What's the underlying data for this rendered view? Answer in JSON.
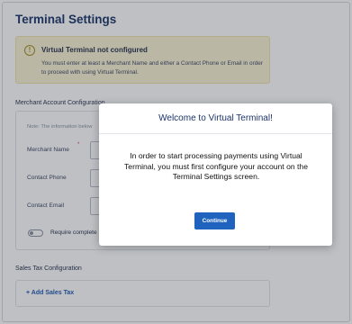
{
  "page": {
    "title": "Terminal Settings"
  },
  "alert": {
    "icon": "warning-circle-icon",
    "title": "Virtual Terminal not configured",
    "body": "You must enter at least a Merchant Name and either a Contact Phone or Email in order to proceed with using Virtual Terminal."
  },
  "merchant": {
    "section_label": "Merchant Account Configuration",
    "note": "Note: The information below",
    "fields": [
      {
        "label": "Merchant Name",
        "required_mark": "*"
      },
      {
        "label": "Contact Phone"
      },
      {
        "label": "Contact Email"
      }
    ],
    "toggle_label": "Require complete"
  },
  "tax": {
    "section_label": "Sales Tax Configuration",
    "add_label": "+ Add Sales Tax"
  },
  "modal": {
    "title": "Welcome to Virtual Terminal!",
    "body": "In order to start processing payments using Virtual Terminal, you must first configure your account on the Terminal Settings screen.",
    "button_label": "Continue"
  },
  "colors": {
    "brand": "#1b3468",
    "primary_button": "#1f63bf",
    "alert_bg": "#fbf3d3"
  }
}
